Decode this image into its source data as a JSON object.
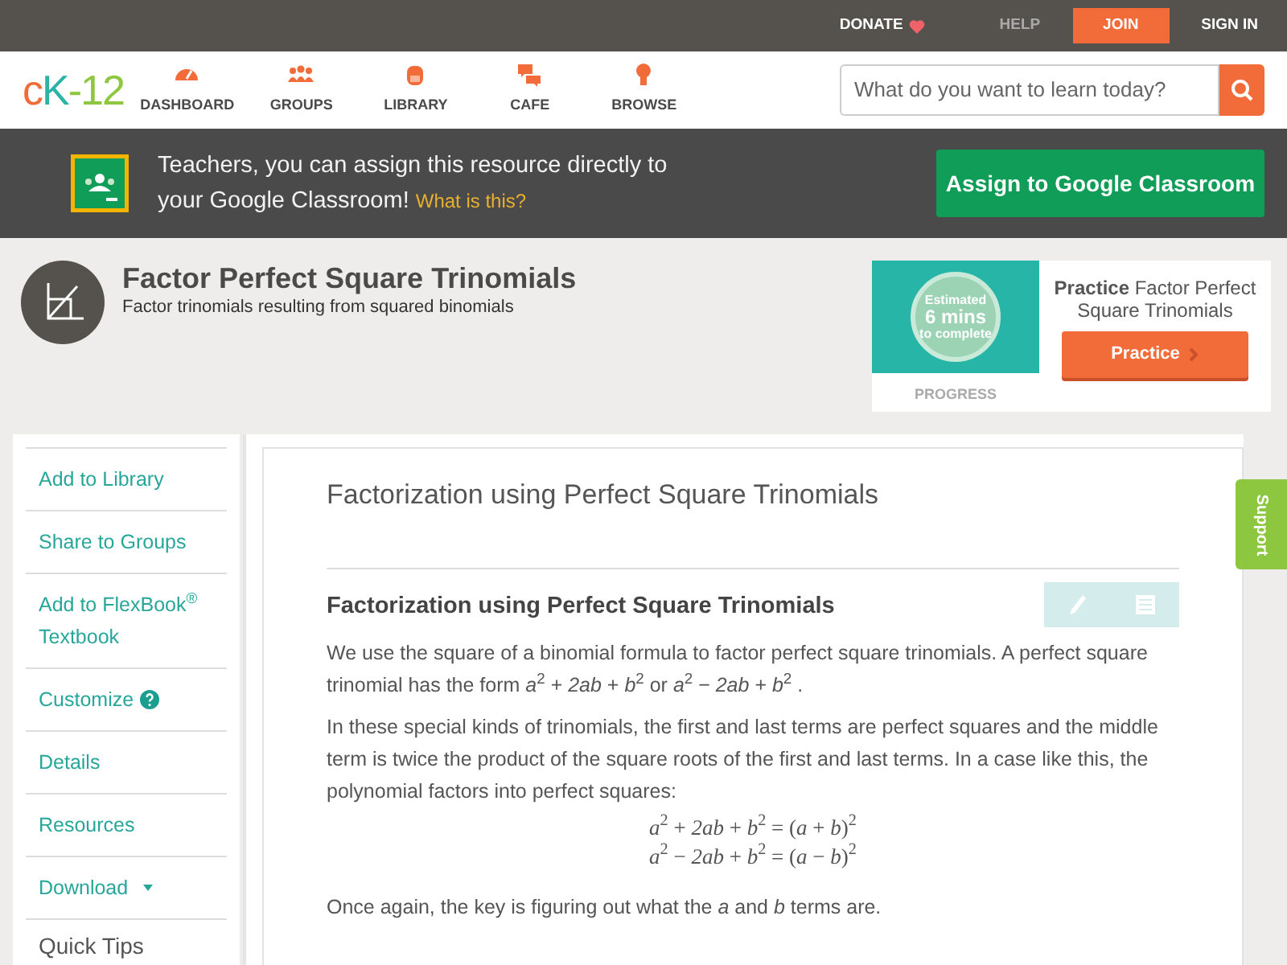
{
  "top_bar": {
    "links": [
      {
        "label": "DONATE",
        "kind": "donate"
      },
      {
        "label": "HELP",
        "kind": "muted"
      },
      {
        "label": "JOIN",
        "kind": "primary"
      },
      {
        "label": "SIGN IN",
        "kind": "plain"
      }
    ]
  },
  "logo": {
    "parts": [
      {
        "text": "c",
        "color": "#f26c3a"
      },
      {
        "text": "K",
        "color": "#2bb3a6"
      },
      {
        "text": "-12",
        "color": "#8dc63f"
      }
    ]
  },
  "nav": [
    {
      "label": "DASHBOARD",
      "kind": "gauge"
    },
    {
      "label": "GROUPS",
      "kind": "people"
    },
    {
      "label": "LIBRARY",
      "kind": "backpack"
    },
    {
      "label": "CAFE",
      "kind": "chat"
    },
    {
      "label": "BROWSE",
      "kind": "bulb"
    }
  ],
  "search": {
    "placeholder": "What do you want to learn today?"
  },
  "classroom_banner": {
    "text": "Teachers, you can assign this resource directly to your Google Classroom!",
    "link": "What is this?",
    "button": "Assign to Google Classroom"
  },
  "concept": {
    "title": "Factor Perfect Square Trinomials",
    "subtitle": "Factor trinomials resulting from squared binomials"
  },
  "practice_card": {
    "estimate": [
      "Estimated",
      "6 mins",
      "to complete"
    ],
    "progress_label": "PROGRESS",
    "title": "**Practice** Factor Perfect Square Trinomials",
    "button": "Practice"
  },
  "sidebar": {
    "items": [
      {
        "label": "Add to Library",
        "kind": "plain"
      },
      {
        "label": "Share to Groups",
        "kind": "plain"
      },
      {
        "label": "Add to FlexBook$^{®}$ Textbook",
        "kind": "plain"
      },
      {
        "label": "Customize",
        "kind": "help"
      },
      {
        "label": "Details",
        "kind": "plain"
      },
      {
        "label": "Resources",
        "kind": "plain"
      },
      {
        "label": "Download",
        "kind": "dropdown"
      }
    ],
    "quick_tips": "Quick Tips"
  },
  "article": {
    "title": "Factorization using Perfect Square Trinomials",
    "section_title": "Factorization using Perfect Square Trinomials",
    "paragraphs": [
      "We use the square of a binomial formula to factor perfect square trinomials. A perfect square trinomial has the form *a*$^{2}$ + *2ab* + *b*$^{2}$  or *a*$^{2}$ − *2ab* + *b*$^{2}$ .",
      "In these special kinds of trinomials, the first and last terms are perfect squares and the middle term is twice the product of the square roots of the first and last terms. In a case like this, the polynomial factors into perfect squares:"
    ],
    "equations": [
      "*a*$^{2}$ + *2ab* + *b*$^{2}$  = (*a* + *b*)$^{2}$",
      "*a*$^{2}$ − *2ab* + *b*$^{2}$  = (*a* − *b*)$^{2}$"
    ],
    "closing": "Once again, the key is figuring out what the *a* and *b* terms are."
  },
  "support_tab": "Support"
}
